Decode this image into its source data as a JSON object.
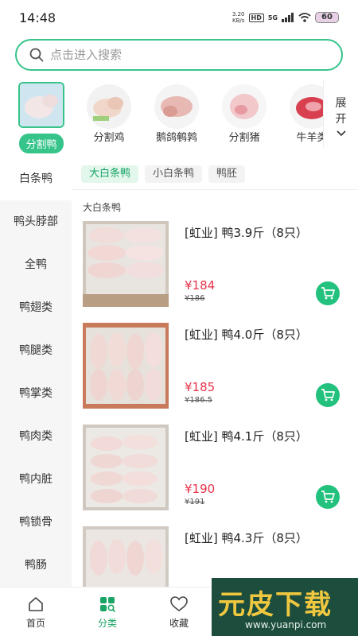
{
  "status_bar": {
    "time": "14:48",
    "net_speed_value": "3.20",
    "net_speed_unit": "KB/s",
    "hd": "HD",
    "network": "5G",
    "battery": "60"
  },
  "search": {
    "placeholder": "点击进入搜索"
  },
  "categories": [
    {
      "label": "分割鸭",
      "active": true
    },
    {
      "label": "分割鸡"
    },
    {
      "label": "鹅鸽鹌鹑"
    },
    {
      "label": "分割猪"
    },
    {
      "label": "牛羊类"
    }
  ],
  "expand": {
    "line1": "展",
    "line2": "开"
  },
  "sidebar": {
    "items": [
      {
        "label": "白条鸭",
        "active": true
      },
      {
        "label": "鸭头脖部"
      },
      {
        "label": "全鸭"
      },
      {
        "label": "鸭翅类"
      },
      {
        "label": "鸭腿类"
      },
      {
        "label": "鸭掌类"
      },
      {
        "label": "鸭肉类"
      },
      {
        "label": "鸭内脏"
      },
      {
        "label": "鸭锁骨"
      },
      {
        "label": "鸭肠"
      }
    ]
  },
  "subtabs": [
    {
      "label": "大白条鸭",
      "active": true
    },
    {
      "label": "小白条鸭"
    },
    {
      "label": "鸭胚"
    }
  ],
  "section_title": "大白条鸭",
  "products": [
    {
      "name": "[虹业] 鸭3.9斤（8只）",
      "price": "¥184",
      "old_price": "¥186"
    },
    {
      "name": "[虹业] 鸭4.0斤（8只）",
      "price": "¥185",
      "old_price": "¥186.5"
    },
    {
      "name": "[虹业] 鸭4.1斤（8只）",
      "price": "¥190",
      "old_price": "¥191"
    },
    {
      "name": "[虹业] 鸭4.3斤（8只）"
    }
  ],
  "bottom_nav": [
    {
      "label": "首页"
    },
    {
      "label": "分类",
      "active": true
    },
    {
      "label": "收藏"
    }
  ],
  "watermark": {
    "title": "元皮下载",
    "url": "www.yuanpi.com"
  },
  "colors": {
    "accent": "#36c48a",
    "price": "#e8334a",
    "cart": "#22c27e"
  }
}
